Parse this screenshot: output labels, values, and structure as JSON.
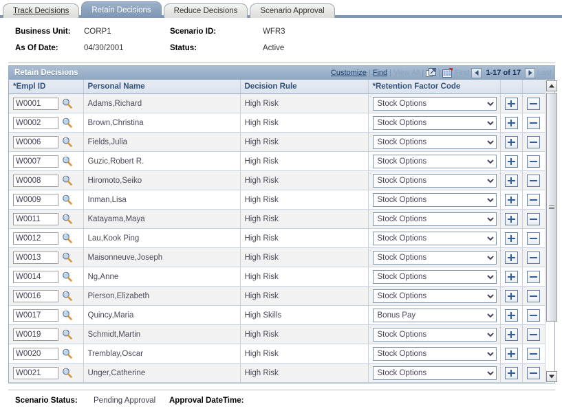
{
  "tabs": [
    {
      "label": "Track Decisions",
      "active": false
    },
    {
      "label": "Retain Decisions",
      "active": true
    },
    {
      "label": "Reduce Decisions",
      "active": false
    },
    {
      "label": "Scenario Approval",
      "active": false
    }
  ],
  "header": {
    "business_unit_label": "Business Unit:",
    "business_unit_value": "CORP1",
    "scenario_id_label": "Scenario ID:",
    "scenario_id_value": "WFR3",
    "as_of_date_label": "As Of Date:",
    "as_of_date_value": "04/30/2001",
    "status_label": "Status:",
    "status_value": "Active"
  },
  "panel": {
    "title": "Retain Decisions",
    "tools": {
      "customize": "Customize",
      "find": "Find",
      "view_all": "View All",
      "sep": "|",
      "expand_icon": "expand-icon",
      "download_icon": "grid-download-icon",
      "first": "First",
      "prev_icon": "prev-arrow-icon",
      "page_count": "1-17 of 17",
      "next_icon": "next-arrow-icon",
      "last": "Last"
    },
    "columns": [
      "*Empl ID",
      "Personal Name",
      "Decision Rule",
      "*Retention Factor Code",
      "",
      ""
    ],
    "add_button_label": "+",
    "remove_button_label": "−",
    "lookup_icon": "lookup-magnifier-icon",
    "rows": [
      {
        "empl_id": "W0001",
        "name": "Adams,Richard",
        "rule": "High Risk",
        "factor": "Stock Options"
      },
      {
        "empl_id": "W0002",
        "name": "Brown,Christina",
        "rule": "High Risk",
        "factor": "Stock Options"
      },
      {
        "empl_id": "W0006",
        "name": "Fields,Julia",
        "rule": "High Risk",
        "factor": "Stock Options"
      },
      {
        "empl_id": "W0007",
        "name": "Guzic,Robert R.",
        "rule": "High Risk",
        "factor": "Stock Options"
      },
      {
        "empl_id": "W0008",
        "name": "Hiromoto,Seiko",
        "rule": "High Risk",
        "factor": "Stock Options"
      },
      {
        "empl_id": "W0009",
        "name": "Inman,Lisa",
        "rule": "High Risk",
        "factor": "Stock Options"
      },
      {
        "empl_id": "W0011",
        "name": "Katayama,Maya",
        "rule": "High Risk",
        "factor": "Stock Options"
      },
      {
        "empl_id": "W0012",
        "name": "Lau,Kook Ping",
        "rule": "High Risk",
        "factor": "Stock Options"
      },
      {
        "empl_id": "W0013",
        "name": "Maisonneuve,Joseph",
        "rule": "High Risk",
        "factor": "Stock Options"
      },
      {
        "empl_id": "W0014",
        "name": "Ng,Anne",
        "rule": "High Risk",
        "factor": "Stock Options"
      },
      {
        "empl_id": "W0016",
        "name": "Pierson,Elizabeth",
        "rule": "High Risk",
        "factor": "Stock Options"
      },
      {
        "empl_id": "W0017",
        "name": "Quincy,Maria",
        "rule": "High Skills",
        "factor": "Bonus Pay"
      },
      {
        "empl_id": "W0019",
        "name": "Schmidt,Martin",
        "rule": "High Risk",
        "factor": "Stock Options"
      },
      {
        "empl_id": "W0020",
        "name": "Tremblay,Oscar",
        "rule": "High Risk",
        "factor": "Stock Options"
      },
      {
        "empl_id": "W0021",
        "name": "Unger,Catherine",
        "rule": "High Risk",
        "factor": "Stock Options"
      }
    ]
  },
  "footer": {
    "scenario_status_label": "Scenario Status:",
    "scenario_status_value": "Pending Approval",
    "approval_datetime_label": "Approval DateTime:",
    "approval_datetime_value": ""
  },
  "colors": {
    "active_tab": "#8aa1bc",
    "panel_header": "#9cb2ca",
    "column_header_text": "#33517c",
    "tab_underline": "#7e96b4"
  }
}
